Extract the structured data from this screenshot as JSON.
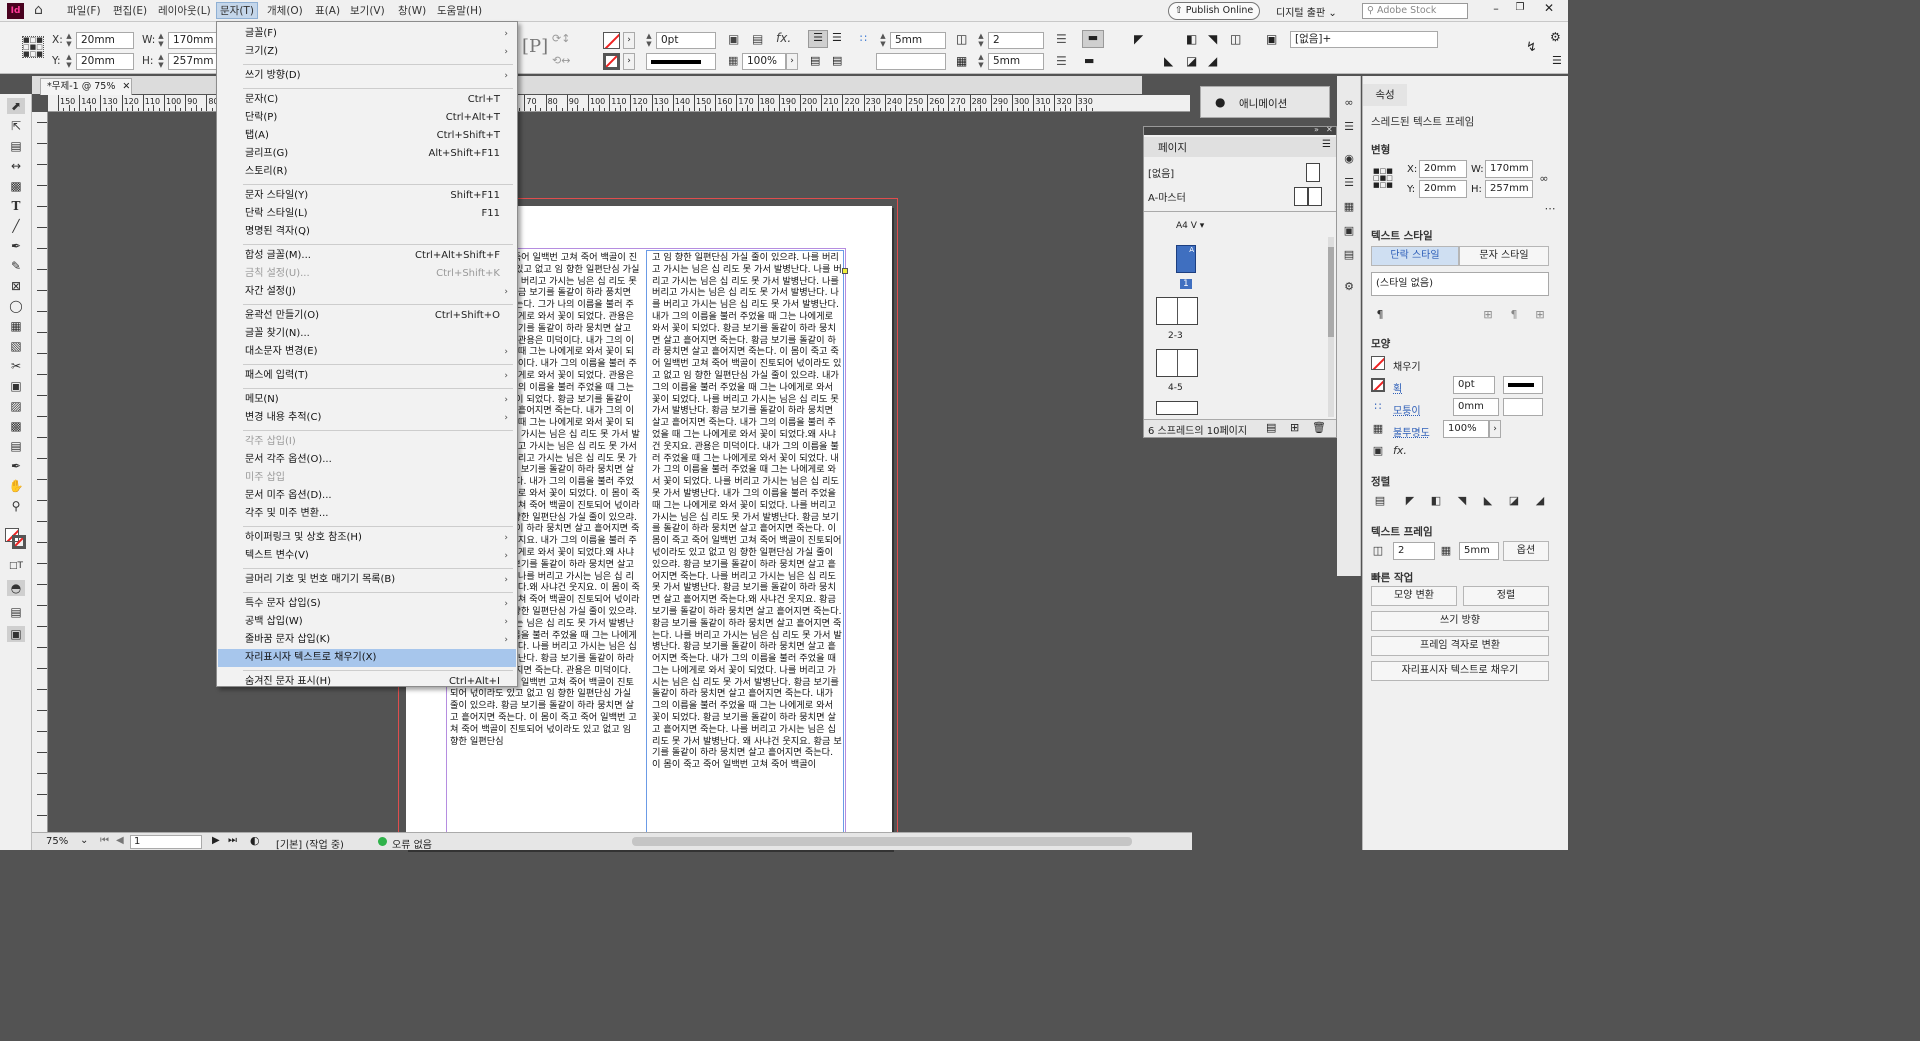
{
  "app": {
    "logo": "Id"
  },
  "menubar": {
    "items": [
      "파일(F)",
      "편집(E)",
      "레이아웃(L)",
      "문자(T)",
      "개체(O)",
      "표(A)",
      "보기(V)",
      "창(W)",
      "도움말(H)"
    ],
    "publish_online": "Publish Online",
    "workspace": "디지털 출판",
    "search_placeholder": "Adobe Stock"
  },
  "control": {
    "x_label": "X:",
    "x_value": "20mm",
    "y_label": "Y:",
    "y_value": "20mm",
    "w_label": "W:",
    "w_value": "170mm",
    "h_label": "H:",
    "h_value": "257mm",
    "stroke_weight": "0pt",
    "opacity": "100%",
    "gutter": "5mm",
    "columns": "2",
    "gutter2": "5mm",
    "object_style": "[없음]+"
  },
  "document": {
    "tab": "*무제-1 @ 75%",
    "ruler_ticks": [
      "150",
      "140",
      "130",
      "120",
      "110",
      "100",
      "90",
      "80",
      "70",
      "60",
      "50",
      "40",
      "30",
      "20",
      "10",
      "0",
      "10",
      "20",
      "30",
      "40",
      "50",
      "60",
      "70",
      "80",
      "90",
      "100",
      "110",
      "120",
      "130",
      "140",
      "150",
      "160",
      "170",
      "180",
      "190",
      "200",
      "210",
      "220",
      "230",
      "240",
      "250",
      "260",
      "270",
      "280",
      "290",
      "300",
      "310",
      "320",
      "330"
    ],
    "col1": "... 이 몸이 죽고 죽어 일백번 고쳐 죽어 백골이 진토되어 넋이라도 있고 없고 임 향한 일편단심 가실 줄이 있으랴. 나를 버리고 가시는 님은 십 리도 못 가서 발병난다. 황금 보기를 돌같이 하라 풍치면 살고 흩어지면 죽는다. 그가 나의 이름을 불러 주었을 때 그는 나에게로 와서 꽃이 되었다. 관용은 미덕이다. 황금 보기를 돌같이 하라 뭉치면 살고 흩어지면 죽는다. 관용은 미덕이다. 내가 그의 이름을 불러 주었을 때 그는 나에게로 와서 꽃이 되었다. 관용은 미덕이다. 내가 그의 이름을 불러 주었을 때 그는 나에게로 와서 꽃이 되었다. 관용은 미덕이다. 내가 그의 이름을 불러 주었을 때 그는 나에게로 와서 꽃이 되었다. 황금 보기를 돌같이 하라 뭉치면 살고 흩어지면 죽는다. 내가 그의 이름을 불러 주었을 때 그는 나에게로 와서 꽃이 되었다. 나를 버리고 가시는 님은 십 리도 못 가서 발병난다. 나를 버리고 가시는 님은 십 리도 못 가서 발병난다. 나를 버리고 가시는 님은 십 리도 못 가서 발병난다. 황금 보기를 돌같이 하라 뭉치면 살고 흩어지면 죽는다. 내가 그의 이름을 불러 주었을 때 그는 나에게로 와서 꽃이 되었다. 이 몸이 죽고 죽어 일백번 고쳐 죽어 백골이 진토되어 넋이라도 있고 없고 임 향한 일편단심 가실 줄이 있으랴. 황금 보기를 돌같이 하라 뭉치면 살고 흩어지면 죽는다.왜 사냐건 웃지요. 내가 그의 이름을 불러 주었을 때 그는 나에게로 와서 꽃이 되었다.왜 사냐건 웃지요. 황금 보기를 돌같이 하라 뭉치면 살고 흩어지면 죽는다. 나를 버리고 가시는 님은 십 리도 못 가서 발병난다.왜 사냐건 웃지요. 이 몸이 죽고 죽어 일백번 고쳐 죽어 백골이 진토되어 넋이라도 있고 없고 임 향한 일편단심 가실 줄이 있으랴. 나를 버리고 가시는 님은 십 리도 못 가서 발병난다. 내가 그의 이름을 불러 주었을 때 그는 나에게로 와서 꽃이 되었다. 나를 버리고 가시는 님은 십 리도 못 가서 발병난다. 황금 보기를 돌같이 하라 뭉치면 살고 흩어지면 죽는다. 관용은 미덕이다. 이 몸이 죽고 죽어 일백번 고쳐 죽어 백골이 진토되어 넋이라도 있고 없고 임 향한 일편단심 가실 줄이 있으랴. 황금 보기를 돌같이 하라 뭉치면 살고 흩어지면 죽는다. 이 몸이 죽고 죽어 일백번 고쳐 죽어 백골이 진토되어 넋이라도 있고 없고 임 향한 일편단심",
    "col2": "고 임 향한 일편단심 가실 줄이 있으랴. 나를 버리고 가시는 님은 십 리도 못 가서 발병난다. 나를 버리고 가시는 님은 십 리도 못 가서 발병난다. 나를 버리고 가시는 님은 십 리도 못 가서 발병난다. 나를 버리고 가시는 님은 십 리도 못 가서 발병난다. 내가 그의 이름을 불러 주었을 때 그는 나에게로 와서 꽃이 되었다. 황금 보기를 돌같이 하라 뭉치면 살고 흩어지면 죽는다. 황금 보기를 돌같이 하라 뭉치면 살고 흩어지면 죽는다. 이 몸이 죽고 죽어 일백번 고쳐 죽어 백골이 진토되어 넋이라도 있고 없고 임 향한 일편단심 가실 줄이 있으랴. 내가 그의 이름을 불러 주었을 때 그는 나에게로 와서 꽃이 되었다. 나를 버리고 가시는 님은 십 리도 못 가서 발병난다. 황금 보기를 돌같이 하라 뭉치면 살고 흩어지면 죽는다. 내가 그의 이름을 불러 주었을 때 그는 나에게로 와서 꽃이 되었다.왜 사냐건 웃지요. 관용은 미덕이다. 내가 그의 이름을 불러 주었을 때 그는 나에게로 와서 꽃이 되었다. 내가 그의 이름을 불러 주었을 때 그는 나에게로 와서 꽃이 되었다. 나를 버리고 가시는 님은 십 리도 못 가서 발병난다. 내가 그의 이름을 불러 주었을 때 그는 나에게로 와서 꽃이 되었다. 나를 버리고 가시는 님은 십 리도 못 가서 발병난다. 황금 보기를 돌같이 하라 뭉치면 살고 흩어지면 죽는다. 이 몸이 죽고 죽어 일백번 고쳐 죽어 백골이 진토되어 넋이라도 있고 없고 임 향한 일편단심 가실 줄이 있으랴. 황금 보기를 돌같이 하라 뭉치면 살고 흩어지면 죽는다. 나를 버리고 가시는 님은 십 리도 못 가서 발병난다. 황금 보기를 돌같이 하라 뭉치면 살고 흩어지면 죽는다.왜 사냐건 웃지요. 황금 보기를 돌같이 하라 뭉치면 살고 흩어지면 죽는다. 황금 보기를 돌같이 하라 뭉치면 살고 흩어지면 죽는다. 나를 버리고 가시는 님은 십 리도 못 가서 발병난다. 황금 보기를 돌같이 하라 뭉치면 살고 흩어지면 죽는다. 내가 그의 이름을 불러 주었을 때 그는 나에게로 와서 꽃이 되었다. 나를 버리고 가시는 님은 십 리도 못 가서 발병난다. 황금 보기를 돌같이 하라 뭉치면 살고 흩어지면 죽는다. 내가 그의 이름을 불러 주었을 때 그는 나에게로 와서 꽃이 되었다. 황금 보기를 돌같이 하라 뭉치면 살고 흩어지면 죽는다. 나를 버리고 가시는 님은 십 리도 못 가서 발병난다. 왜 사냐건 웃지요. 황금 보기를 돌같이 하라 뭉치면 살고 흩어지면 죽는다. 이 몸이 죽고 죽어 일백번 고쳐 죽어 백골이"
  },
  "type_menu": [
    {
      "label": "글꼴(F)",
      "shortcut": "",
      "arrow": true,
      "disabled": false
    },
    {
      "label": "크기(Z)",
      "shortcut": "",
      "arrow": true,
      "disabled": false
    },
    {
      "sep": true
    },
    {
      "label": "쓰기 방향(D)",
      "shortcut": "",
      "arrow": true,
      "disabled": false
    },
    {
      "sep": true
    },
    {
      "label": "문자(C)",
      "shortcut": "Ctrl+T",
      "arrow": false,
      "disabled": false
    },
    {
      "label": "단락(P)",
      "shortcut": "Ctrl+Alt+T",
      "arrow": false,
      "disabled": false
    },
    {
      "label": "탭(A)",
      "shortcut": "Ctrl+Shift+T",
      "arrow": false,
      "disabled": false
    },
    {
      "label": "글리프(G)",
      "shortcut": "Alt+Shift+F11",
      "arrow": false,
      "disabled": false
    },
    {
      "label": "스토리(R)",
      "shortcut": "",
      "arrow": false,
      "disabled": false
    },
    {
      "sep": true
    },
    {
      "label": "문자 스타일(Y)",
      "shortcut": "Shift+F11",
      "arrow": false,
      "disabled": false
    },
    {
      "label": "단락 스타일(L)",
      "shortcut": "F11",
      "arrow": false,
      "disabled": false
    },
    {
      "label": "명명된 격자(Q)",
      "shortcut": "",
      "arrow": false,
      "disabled": false
    },
    {
      "sep": true
    },
    {
      "label": "합성 글꼴(M)...",
      "shortcut": "Ctrl+Alt+Shift+F",
      "arrow": false,
      "disabled": false
    },
    {
      "label": "금칙 설정(U)...",
      "shortcut": "Ctrl+Shift+K",
      "arrow": false,
      "disabled": true
    },
    {
      "label": "자간 설정(J)",
      "shortcut": "",
      "arrow": true,
      "disabled": false
    },
    {
      "sep": true
    },
    {
      "label": "윤곽선 만들기(O)",
      "shortcut": "Ctrl+Shift+O",
      "arrow": false,
      "disabled": false
    },
    {
      "label": "글꼴 찾기(N)...",
      "shortcut": "",
      "arrow": false,
      "disabled": false
    },
    {
      "label": "대소문자 변경(E)",
      "shortcut": "",
      "arrow": true,
      "disabled": false
    },
    {
      "sep": true
    },
    {
      "label": "패스에 입력(T)",
      "shortcut": "",
      "arrow": true,
      "disabled": false
    },
    {
      "sep": true
    },
    {
      "label": "메모(N)",
      "shortcut": "",
      "arrow": true,
      "disabled": false
    },
    {
      "label": "변경 내용 추적(C)",
      "shortcut": "",
      "arrow": true,
      "disabled": false
    },
    {
      "sep": true
    },
    {
      "label": "각주 삽입(I)",
      "shortcut": "",
      "arrow": false,
      "disabled": true
    },
    {
      "label": "문서 각주 옵션(O)...",
      "shortcut": "",
      "arrow": false,
      "disabled": false
    },
    {
      "label": "미주 삽입",
      "shortcut": "",
      "arrow": false,
      "disabled": true
    },
    {
      "label": "문서 미주 옵션(D)...",
      "shortcut": "",
      "arrow": false,
      "disabled": false
    },
    {
      "label": "각주 및 미주 변환...",
      "shortcut": "",
      "arrow": false,
      "disabled": false
    },
    {
      "sep": true
    },
    {
      "label": "하이퍼링크 및 상호 참조(H)",
      "shortcut": "",
      "arrow": true,
      "disabled": false
    },
    {
      "label": "텍스트 변수(V)",
      "shortcut": "",
      "arrow": true,
      "disabled": false
    },
    {
      "sep": true
    },
    {
      "label": "글머리 기호 및 번호 매기기 목록(B)",
      "shortcut": "",
      "arrow": true,
      "disabled": false
    },
    {
      "sep": true
    },
    {
      "label": "특수 문자 삽입(S)",
      "shortcut": "",
      "arrow": true,
      "disabled": false
    },
    {
      "label": "공백 삽입(W)",
      "shortcut": "",
      "arrow": true,
      "disabled": false
    },
    {
      "label": "줄바꿈 문자 삽입(K)",
      "shortcut": "",
      "arrow": true,
      "disabled": false
    },
    {
      "label": "자리표시자 텍스트로 채우기(X)",
      "shortcut": "",
      "arrow": false,
      "disabled": false,
      "highlight": true
    },
    {
      "sep": true
    },
    {
      "label": "숨겨진 문자 표시(H)",
      "shortcut": "Ctrl+Alt+I",
      "arrow": false,
      "disabled": false
    }
  ],
  "animation_panel": {
    "title": "애니메이션"
  },
  "pages_panel": {
    "title": "페이지",
    "none": "[없음]",
    "master": "A-마스터",
    "size": "A4 V",
    "page_labels": [
      "1",
      "2-3",
      "4-5"
    ],
    "footer": "6 스프레드의 10페이지"
  },
  "properties": {
    "tab": "속성",
    "object_type": "스레드된 텍스트 프레임",
    "transform_title": "변형",
    "x_label": "X:",
    "x": "20mm",
    "y_label": "Y:",
    "y": "20mm",
    "w_label": "W:",
    "w": "170mm",
    "h_label": "H:",
    "h": "257mm",
    "text_style_title": "텍스트 스타일",
    "para_style_tab": "단락 스타일",
    "char_style_tab": "문자 스타일",
    "style_value": "(스타일 없음)",
    "appearance_title": "모양",
    "fill": "채우기",
    "stroke": "획",
    "stroke_weight": "0pt",
    "corner": "모퉁이",
    "corner_value": "0mm",
    "opacity_label": "불투명도",
    "opacity": "100%",
    "align_title": "정렬",
    "text_frame_title": "텍스트 프레임",
    "columns": "2",
    "gutter": "5mm",
    "options": "옵션",
    "quick_actions_title": "빠른 작업",
    "qa_shape": "모양 변환",
    "qa_align": "정렬",
    "qa_writing": "쓰기 방향",
    "qa_grid": "프레임 격자로 변환",
    "qa_fill": "자리표시자 텍스트로 채우기"
  },
  "status": {
    "zoom": "75%",
    "page": "1",
    "mode": "[기본] (작업 중)",
    "errors": "오류 없음"
  }
}
